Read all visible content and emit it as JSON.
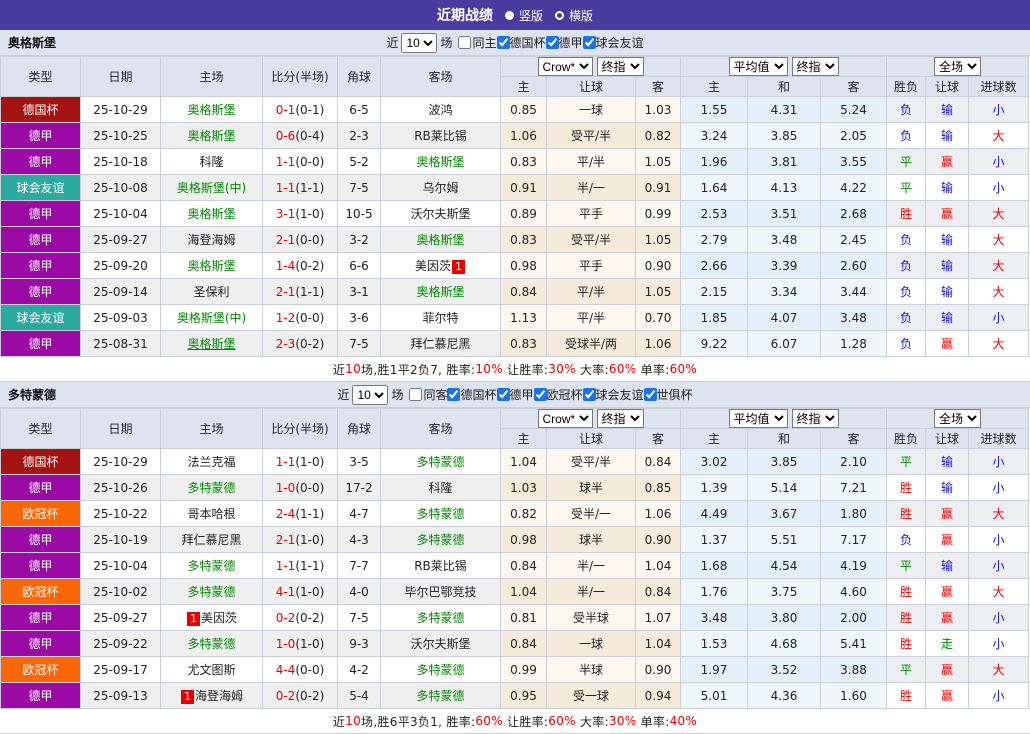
{
  "topbar": {
    "title": "近期战绩",
    "radios": [
      {
        "label": "竖版",
        "selected": true
      },
      {
        "label": "横版",
        "selected": false
      }
    ]
  },
  "filter_labels": {
    "near": "近",
    "games": "场"
  },
  "columns": {
    "main": [
      "类型",
      "日期",
      "主场",
      "比分(半场)",
      "角球",
      "客场"
    ],
    "group1": {
      "selects": [
        "Crow*",
        "终指"
      ],
      "subs": [
        "主",
        "让球",
        "客"
      ]
    },
    "group2": {
      "selects": [
        "平均值",
        "终指"
      ],
      "subs": [
        "主",
        "和",
        "客"
      ]
    },
    "group3": {
      "selects": [
        "全场"
      ],
      "subs": [
        "胜负",
        "让球",
        "进球数"
      ]
    }
  },
  "colors": {
    "topbar": "#493c9e",
    "accent_red": "#e60000",
    "accent_green": "#008800",
    "accent_blue": "#1414cc",
    "league": {
      "德国杯": "#a31312",
      "德甲": "#9b0aa5",
      "欧冠杯": "#f96605",
      "球会友谊": "#2baaa0"
    },
    "result_class": {
      "胜": "red",
      "平": "green",
      "负": "blue",
      "赢": "red",
      "走": "green",
      "输": "blue",
      "大": "red",
      "小": "blue"
    }
  },
  "sections": [
    {
      "team": "奥格斯堡",
      "filter": {
        "count": "10",
        "same_label": "同主",
        "same_checked": false,
        "leagues": [
          {
            "label": "德国杯",
            "checked": true
          },
          {
            "label": "德甲",
            "checked": true
          },
          {
            "label": "球会友谊",
            "checked": true
          }
        ]
      },
      "rows": [
        {
          "league": "德国杯",
          "date": "25-10-29",
          "home": {
            "name": "奥格斯堡",
            "green": true
          },
          "score": "0-1",
          "half": "(0-1)",
          "corner": "6-5",
          "away": {
            "name": "波鸿"
          },
          "h1": "0.85",
          "handicap": "一球",
          "h2": "1.03",
          "a1": "1.55",
          "a2": "4.31",
          "a3": "5.24",
          "r1": "负",
          "r2": "输",
          "r3": "小"
        },
        {
          "league": "德甲",
          "date": "25-10-25",
          "home": {
            "name": "奥格斯堡",
            "green": true
          },
          "score": "0-6",
          "half": "(0-4)",
          "corner": "2-3",
          "away": {
            "name": "RB莱比锡"
          },
          "h1": "1.06",
          "handicap": "受平/半",
          "h2": "0.82",
          "a1": "3.24",
          "a2": "3.85",
          "a3": "2.05",
          "r1": "负",
          "r2": "输",
          "r3": "大"
        },
        {
          "league": "德甲",
          "date": "25-10-18",
          "home": {
            "name": "科隆"
          },
          "score": "1-1",
          "half": "(0-0)",
          "corner": "5-2",
          "away": {
            "name": "奥格斯堡",
            "green": true
          },
          "h1": "0.83",
          "handicap": "平/半",
          "h2": "1.05",
          "a1": "1.96",
          "a2": "3.81",
          "a3": "3.55",
          "r1": "平",
          "r2": "赢",
          "r3": "小"
        },
        {
          "league": "球会友谊",
          "date": "25-10-08",
          "home": {
            "name": "奥格斯堡(中)",
            "green": true
          },
          "score": "1-1",
          "half": "(1-1)",
          "corner": "7-5",
          "away": {
            "name": "乌尔姆"
          },
          "h1": "0.91",
          "handicap": "半/一",
          "h2": "0.91",
          "a1": "1.64",
          "a2": "4.13",
          "a3": "4.22",
          "r1": "平",
          "r2": "输",
          "r3": "小"
        },
        {
          "league": "德甲",
          "date": "25-10-04",
          "home": {
            "name": "奥格斯堡",
            "green": true
          },
          "score": "3-1",
          "half": "(1-0)",
          "corner": "10-5",
          "away": {
            "name": "沃尔夫斯堡"
          },
          "h1": "0.89",
          "handicap": "平手",
          "h2": "0.99",
          "a1": "2.53",
          "a2": "3.51",
          "a3": "2.68",
          "r1": "胜",
          "r2": "赢",
          "r3": "大"
        },
        {
          "league": "德甲",
          "date": "25-09-27",
          "home": {
            "name": "海登海姆"
          },
          "score": "2-1",
          "half": "(0-0)",
          "corner": "3-2",
          "away": {
            "name": "奥格斯堡",
            "green": true
          },
          "h1": "0.83",
          "handicap": "受平/半",
          "h2": "1.05",
          "a1": "2.79",
          "a2": "3.48",
          "a3": "2.45",
          "r1": "负",
          "r2": "输",
          "r3": "大"
        },
        {
          "league": "德甲",
          "date": "25-09-20",
          "home": {
            "name": "奥格斯堡",
            "green": true
          },
          "score": "1-4",
          "half": "(0-2)",
          "corner": "6-6",
          "away": {
            "name": "美因茨",
            "badge": "1",
            "badge_pos": "after"
          },
          "h1": "0.98",
          "handicap": "平手",
          "h2": "0.90",
          "a1": "2.66",
          "a2": "3.39",
          "a3": "2.60",
          "r1": "负",
          "r2": "输",
          "r3": "大"
        },
        {
          "league": "德甲",
          "date": "25-09-14",
          "home": {
            "name": "圣保利"
          },
          "score": "2-1",
          "half": "(1-1)",
          "corner": "3-1",
          "away": {
            "name": "奥格斯堡",
            "green": true
          },
          "h1": "0.84",
          "handicap": "平/半",
          "h2": "1.05",
          "a1": "2.15",
          "a2": "3.34",
          "a3": "3.44",
          "r1": "负",
          "r2": "输",
          "r3": "大"
        },
        {
          "league": "球会友谊",
          "date": "25-09-03",
          "home": {
            "name": "奥格斯堡(中)",
            "green": true
          },
          "score": "1-2",
          "half": "(0-0)",
          "corner": "3-6",
          "away": {
            "name": "菲尔特"
          },
          "h1": "1.13",
          "handicap": "平/半",
          "h2": "0.70",
          "a1": "1.85",
          "a2": "4.07",
          "a3": "3.48",
          "r1": "负",
          "r2": "输",
          "r3": "小"
        },
        {
          "league": "德甲",
          "date": "25-08-31",
          "home": {
            "name": "奥格斯堡",
            "green": true,
            "underline": true
          },
          "score": "2-3",
          "half": "(0-2)",
          "corner": "7-5",
          "away": {
            "name": "拜仁慕尼黑"
          },
          "h1": "0.83",
          "handicap": "受球半/两",
          "h2": "1.06",
          "a1": "9.22",
          "a2": "6.07",
          "a3": "1.28",
          "r1": "负",
          "r2": "赢",
          "r3": "大"
        }
      ],
      "summary": [
        {
          "t": "近"
        },
        {
          "t": "10",
          "red": true
        },
        {
          "t": "场,胜1平2负7, 胜率:"
        },
        {
          "t": "10%",
          "red": true
        },
        {
          "t": " 让胜率:"
        },
        {
          "t": "30%",
          "red": true
        },
        {
          "t": " 大率:"
        },
        {
          "t": "60%",
          "red": true
        },
        {
          "t": " 单率:"
        },
        {
          "t": "60%",
          "red": true
        }
      ]
    },
    {
      "team": "多特蒙德",
      "filter": {
        "count": "10",
        "same_label": "同客",
        "same_checked": false,
        "leagues": [
          {
            "label": "德国杯",
            "checked": true
          },
          {
            "label": "德甲",
            "checked": true
          },
          {
            "label": "欧冠杯",
            "checked": true
          },
          {
            "label": "球会友谊",
            "checked": true
          },
          {
            "label": "世俱杯",
            "checked": true
          }
        ]
      },
      "rows": [
        {
          "league": "德国杯",
          "date": "25-10-29",
          "home": {
            "name": "法兰克福"
          },
          "score": "1-1",
          "half": "(1-0)",
          "corner": "3-5",
          "away": {
            "name": "多特蒙德",
            "green": true
          },
          "h1": "1.04",
          "handicap": "受平/半",
          "h2": "0.84",
          "a1": "3.02",
          "a2": "3.85",
          "a3": "2.10",
          "r1": "平",
          "r2": "输",
          "r3": "小"
        },
        {
          "league": "德甲",
          "date": "25-10-26",
          "home": {
            "name": "多特蒙德",
            "green": true
          },
          "score": "1-0",
          "half": "(0-0)",
          "corner": "17-2",
          "away": {
            "name": "科隆"
          },
          "h1": "1.03",
          "handicap": "球半",
          "h2": "0.85",
          "a1": "1.39",
          "a2": "5.14",
          "a3": "7.21",
          "r1": "胜",
          "r2": "输",
          "r3": "小"
        },
        {
          "league": "欧冠杯",
          "date": "25-10-22",
          "home": {
            "name": "哥本哈根"
          },
          "score": "2-4",
          "half": "(1-1)",
          "corner": "4-7",
          "away": {
            "name": "多特蒙德",
            "green": true
          },
          "h1": "0.82",
          "handicap": "受半/一",
          "h2": "1.06",
          "a1": "4.49",
          "a2": "3.67",
          "a3": "1.80",
          "r1": "胜",
          "r2": "赢",
          "r3": "大"
        },
        {
          "league": "德甲",
          "date": "25-10-19",
          "home": {
            "name": "拜仁慕尼黑"
          },
          "score": "2-1",
          "half": "(1-0)",
          "corner": "4-3",
          "away": {
            "name": "多特蒙德",
            "green": true
          },
          "h1": "0.98",
          "handicap": "球半",
          "h2": "0.90",
          "a1": "1.37",
          "a2": "5.51",
          "a3": "7.17",
          "r1": "负",
          "r2": "赢",
          "r3": "小"
        },
        {
          "league": "德甲",
          "date": "25-10-04",
          "home": {
            "name": "多特蒙德",
            "green": true
          },
          "score": "1-1",
          "half": "(1-1)",
          "corner": "7-7",
          "away": {
            "name": "RB莱比锡"
          },
          "h1": "0.84",
          "handicap": "半/一",
          "h2": "1.04",
          "a1": "1.68",
          "a2": "4.54",
          "a3": "4.19",
          "r1": "平",
          "r2": "输",
          "r3": "小"
        },
        {
          "league": "欧冠杯",
          "date": "25-10-02",
          "home": {
            "name": "多特蒙德",
            "green": true
          },
          "score": "4-1",
          "half": "(1-0)",
          "corner": "4-0",
          "away": {
            "name": "毕尔巴鄂竞技"
          },
          "h1": "1.04",
          "handicap": "半/一",
          "h2": "0.84",
          "a1": "1.76",
          "a2": "3.75",
          "a3": "4.60",
          "r1": "胜",
          "r2": "赢",
          "r3": "大"
        },
        {
          "league": "德甲",
          "date": "25-09-27",
          "home": {
            "name": "美因茨",
            "badge": "1",
            "badge_pos": "before"
          },
          "score": "0-2",
          "half": "(0-2)",
          "corner": "7-5",
          "away": {
            "name": "多特蒙德",
            "green": true
          },
          "h1": "0.81",
          "handicap": "受半球",
          "h2": "1.07",
          "a1": "3.48",
          "a2": "3.80",
          "a3": "2.00",
          "r1": "胜",
          "r2": "赢",
          "r3": "小"
        },
        {
          "league": "德甲",
          "date": "25-09-22",
          "home": {
            "name": "多特蒙德",
            "green": true
          },
          "score": "1-0",
          "half": "(1-0)",
          "corner": "9-3",
          "away": {
            "name": "沃尔夫斯堡"
          },
          "h1": "0.84",
          "handicap": "一球",
          "h2": "1.04",
          "a1": "1.53",
          "a2": "4.68",
          "a3": "5.41",
          "r1": "胜",
          "r2": "走",
          "r3": "小"
        },
        {
          "league": "欧冠杯",
          "date": "25-09-17",
          "home": {
            "name": "尤文图斯"
          },
          "score": "4-4",
          "half": "(0-0)",
          "corner": "4-2",
          "away": {
            "name": "多特蒙德",
            "green": true
          },
          "h1": "0.99",
          "handicap": "半球",
          "h2": "0.90",
          "a1": "1.97",
          "a2": "3.52",
          "a3": "3.88",
          "r1": "平",
          "r2": "赢",
          "r3": "大"
        },
        {
          "league": "德甲",
          "date": "25-09-13",
          "home": {
            "name": "海登海姆",
            "badge": "1",
            "badge_pos": "before"
          },
          "score": "0-2",
          "half": "(0-2)",
          "corner": "5-4",
          "away": {
            "name": "多特蒙德",
            "green": true
          },
          "h1": "0.95",
          "handicap": "受一球",
          "h2": "0.94",
          "a1": "5.01",
          "a2": "4.36",
          "a3": "1.60",
          "r1": "胜",
          "r2": "赢",
          "r3": "小"
        }
      ],
      "summary": [
        {
          "t": "近"
        },
        {
          "t": "10",
          "red": true
        },
        {
          "t": "场,胜6平3负1, 胜率:"
        },
        {
          "t": "60%",
          "red": true
        },
        {
          "t": " 让胜率:"
        },
        {
          "t": "60%",
          "red": true
        },
        {
          "t": " 大率:"
        },
        {
          "t": "30%",
          "red": true
        },
        {
          "t": " 单率:"
        },
        {
          "t": "40%",
          "red": true
        }
      ]
    }
  ]
}
